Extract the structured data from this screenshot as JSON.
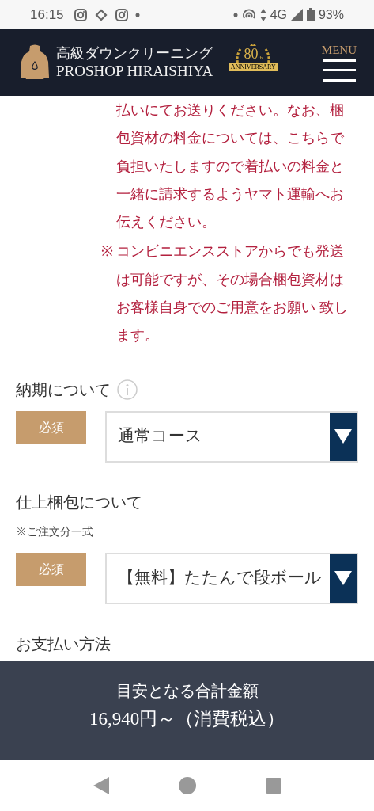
{
  "status_bar": {
    "time": "16:15",
    "network": "4G",
    "battery": "93%"
  },
  "header": {
    "title_jp": "高級ダウンクリーニング",
    "title_en": "PROSHOP HIRAISHIYA",
    "anniversary": {
      "number": "80",
      "suffix": "th",
      "caption": "ANNIVERSARY"
    },
    "menu_label": "MENU"
  },
  "notes": [
    {
      "text": "払いにてお送りください。なお、梱包資材の料金については、こちらで負担いたしますので着払いの料金と一緒に請求するようヤマト運輸へお伝えください。"
    },
    {
      "marker": "※",
      "text": "コンビニエンスストアからでも発送は可能ですが、その場合梱包資材はお客様自身でのご用意をお願い 致します。"
    }
  ],
  "fields": [
    {
      "label": "納期について",
      "info": true,
      "required": "必須",
      "value": "通常コース"
    },
    {
      "label": "仕上梱包について",
      "note": "※ご注文分一式",
      "info": false,
      "required": "必須",
      "value": "【無料】たたんで段ボール"
    },
    {
      "label": "お支払い方法",
      "info": false
    }
  ],
  "summary": {
    "label": "目安となる合計金額",
    "price": "16,940円～（消費税込）"
  }
}
